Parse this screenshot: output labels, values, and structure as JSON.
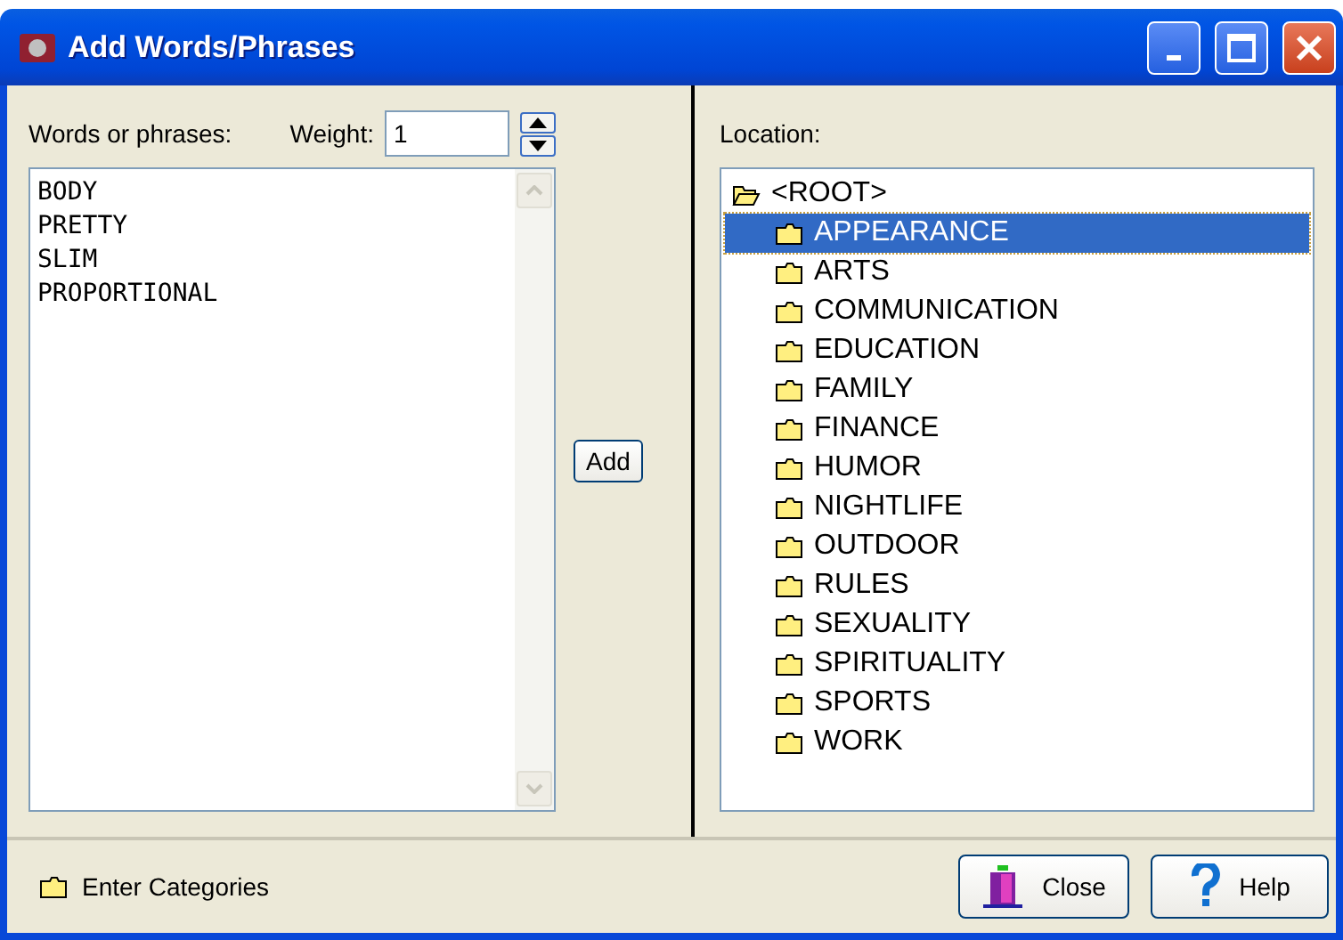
{
  "window": {
    "title": "Add Words/Phrases"
  },
  "words_panel": {
    "label": "Words or phrases:",
    "weight_label": "Weight:",
    "weight_value": "1",
    "lines": [
      "BODY",
      "PRETTY",
      "SLIM",
      "PROPORTIONAL"
    ],
    "add_button": "Add"
  },
  "location_panel": {
    "label": "Location:",
    "tree": [
      {
        "label": "<ROOT>",
        "expanded": true,
        "selected": false,
        "children": [
          {
            "label": "APPEARANCE",
            "selected": true
          },
          {
            "label": "ARTS",
            "selected": false
          },
          {
            "label": "COMMUNICATION",
            "selected": false
          },
          {
            "label": "EDUCATION",
            "selected": false
          },
          {
            "label": "FAMILY",
            "selected": false
          },
          {
            "label": "FINANCE",
            "selected": false
          },
          {
            "label": "HUMOR",
            "selected": false
          },
          {
            "label": "NIGHTLIFE",
            "selected": false
          },
          {
            "label": "OUTDOOR",
            "selected": false
          },
          {
            "label": "RULES",
            "selected": false
          },
          {
            "label": "SEXUALITY",
            "selected": false
          },
          {
            "label": "SPIRITUALITY",
            "selected": false
          },
          {
            "label": "SPORTS",
            "selected": false
          },
          {
            "label": "WORK",
            "selected": false
          }
        ]
      }
    ]
  },
  "status_bar": {
    "text": "Enter Categories"
  },
  "buttons": [
    {
      "kind": "close",
      "label": "Close"
    },
    {
      "kind": "help",
      "label": "Help"
    }
  ]
}
